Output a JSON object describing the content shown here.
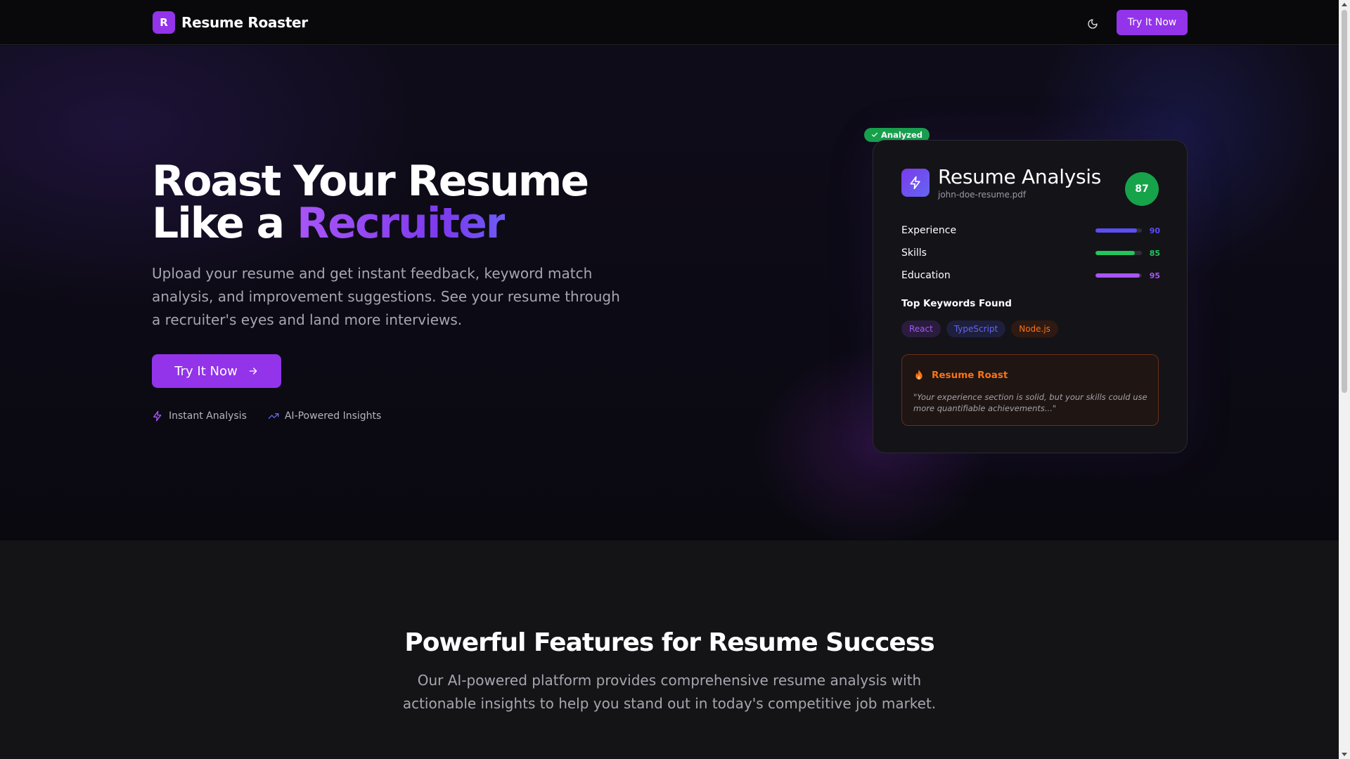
{
  "nav": {
    "logo_letter": "R",
    "brand": "Resume Roaster",
    "theme_icon": "moon-icon",
    "cta_label": "Try It Now"
  },
  "hero": {
    "title_line1": "Roast Your Resume",
    "title_line2_prefix": "Like a ",
    "title_line2_accent": "Recruiter",
    "subtitle": "Upload your resume and get instant feedback, keyword match analysis, and improvement suggestions. See your resume through a recruiter's eyes and land more interviews.",
    "cta_label": "Try It Now",
    "cta_icon": "arrow-right-icon",
    "badges": [
      {
        "icon": "lightning-icon",
        "label": "Instant Analysis"
      },
      {
        "icon": "trending-up-icon",
        "label": "AI-Powered Insights"
      }
    ]
  },
  "card": {
    "status_pill": "Analyzed",
    "title": "Resume Analysis",
    "filename": "john-doe-resume.pdf",
    "score": "87",
    "metrics": [
      {
        "label": "Experience",
        "value": 90,
        "color": "#5b4ef2"
      },
      {
        "label": "Skills",
        "value": 85,
        "color": "#22c55e"
      },
      {
        "label": "Education",
        "value": 95,
        "color": "#a855f7"
      }
    ],
    "keywords_heading": "Top Keywords Found",
    "keywords": [
      {
        "label": "React",
        "color": "#a855f7",
        "bg": "#2a1c3e"
      },
      {
        "label": "TypeScript",
        "color": "#6366f1",
        "bg": "#1e1f3d"
      },
      {
        "label": "Node.js",
        "color": "#f97316",
        "bg": "#2e1a12"
      }
    ],
    "roast": {
      "title": "Resume Roast",
      "quote": "\"Your experience section is solid, but your skills could use more quantifiable achievements...\""
    }
  },
  "features": {
    "title": "Powerful Features for Resume Success",
    "subtitle": "Our AI-powered platform provides comprehensive resume analysis with actionable insights to help you stand out in today's competitive job market."
  },
  "colors": {
    "brand_purple": "#9333ea",
    "success_green": "#16a34a",
    "roast_orange": "#f97316"
  }
}
